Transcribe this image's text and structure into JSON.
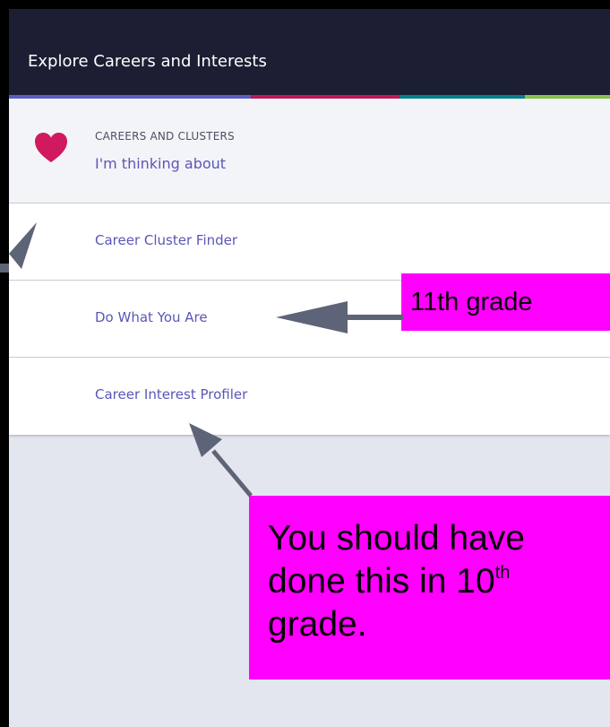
{
  "header": {
    "title": "Explore Careers and Interests",
    "stripe_colors": [
      "#5b5fc7",
      "#c2185b",
      "#00838f",
      "#8bc34a"
    ]
  },
  "cluster": {
    "icon": "heart-icon",
    "icon_color": "#d0195e",
    "caption": "CAREERS AND CLUSTERS",
    "link_label": "I'm thinking about"
  },
  "menu": {
    "items": [
      {
        "label": "Career Cluster Finder"
      },
      {
        "label": "Do What You Are"
      },
      {
        "label": "Career Interest Profiler"
      }
    ]
  },
  "annotations": {
    "grade_note": "11th grade",
    "tenth_note_pre": "You should have done this in 10",
    "tenth_note_sup": "th",
    "tenth_note_post": "grade.",
    "note_color": "#ff00ff",
    "arrow_color": "#5e6478"
  }
}
